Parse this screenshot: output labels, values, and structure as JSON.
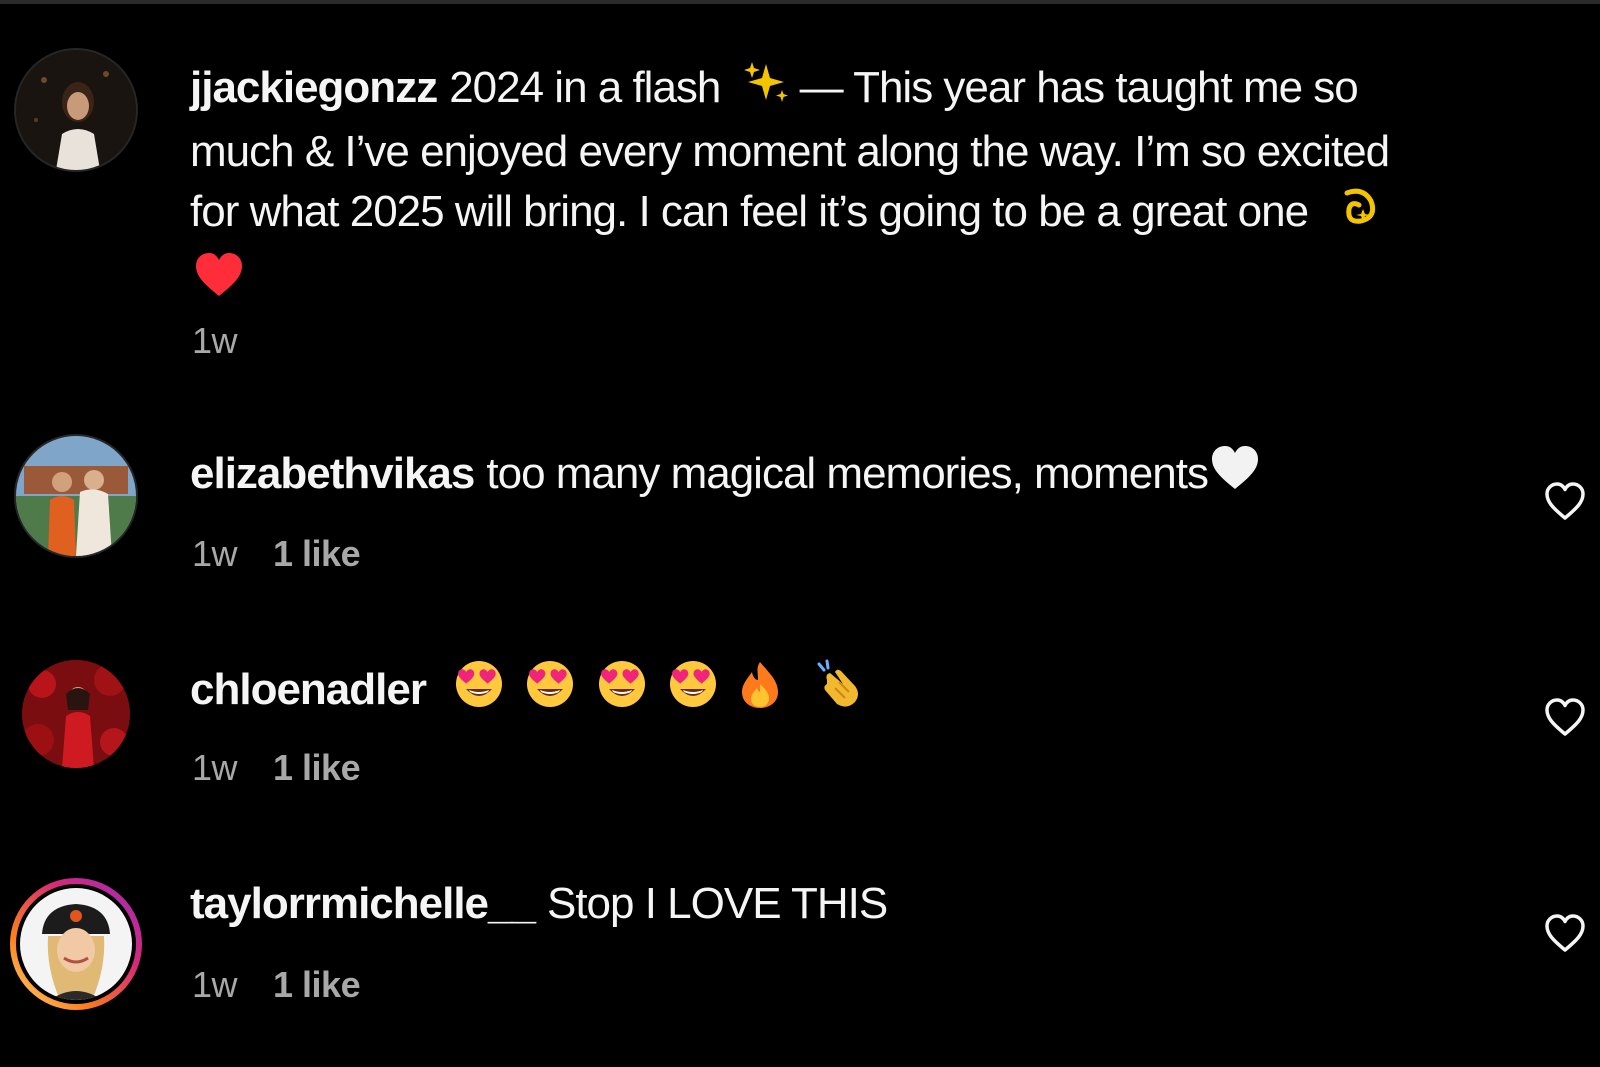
{
  "colors": {
    "background": "#000000",
    "text": "#f5f5f5",
    "meta_text": "#a8a8a8",
    "heart_red": "#ff3040",
    "story_ring_start": "#d62976",
    "story_ring_end": "#feda75"
  },
  "caption": {
    "username": "jjackiegonzz",
    "line1_prefix": "2024 in a flash",
    "line1_sparkles_icon": "sparkles-emoji",
    "line1_suffix": "— This year has taught me so",
    "line2": "much & I’ve enjoyed every moment along the way. I’m so excited",
    "line3": "for what 2025 will bring. I can feel it’s going to be a great one",
    "line3_icon": "dizzy-emoji",
    "line4_icon": "red-heart-emoji",
    "time": "1w"
  },
  "comments": [
    {
      "username": "elizabethvikas",
      "text": "too many magical memories, moments",
      "trailing_icon": "white-heart-emoji",
      "time": "1w",
      "likes": "1 like"
    },
    {
      "username": "chloenadler",
      "icons": [
        "heart-eyes-emoji",
        "heart-eyes-emoji",
        "heart-eyes-emoji",
        "heart-eyes-emoji",
        "fire-emoji",
        "clapping-hands-emoji"
      ],
      "time": "1w",
      "likes": "1 like"
    },
    {
      "username": "taylorrmichelle__",
      "text": "Stop I LOVE THIS",
      "time": "1w",
      "likes": "1 like"
    }
  ],
  "icons": {
    "like": "heart-outline-icon"
  }
}
